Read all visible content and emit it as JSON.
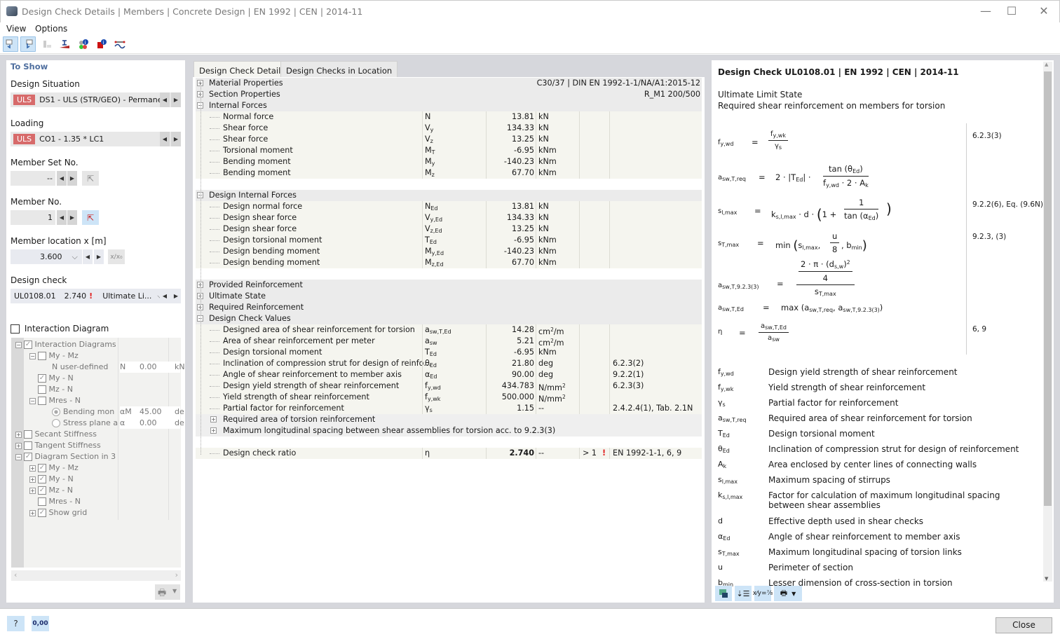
{
  "window": {
    "title": "Design Check Details | Members | Concrete Design | EN 1992 | CEN | 2014-11",
    "minimize": "—",
    "maximize": "☐",
    "close": "✕"
  },
  "menu": [
    "View",
    "Options"
  ],
  "toolbar": {
    "icons": [
      "select-previous-icon",
      "select-next-icon",
      "list-icon",
      "section-icon",
      "info-colors-icon",
      "member-info-icon",
      "reinforcement-icon"
    ]
  },
  "left": {
    "section_title": "To Show",
    "design_situation": {
      "label": "Design Situation",
      "badge": "ULS",
      "value": "DS1 - ULS (STR/GEO) - Permane..."
    },
    "loading": {
      "label": "Loading",
      "badge": "ULS",
      "value": "CO1 - 1.35 * LC1"
    },
    "member_set": {
      "label": "Member Set No.",
      "value": "--"
    },
    "member_no": {
      "label": "Member No.",
      "value": "1"
    },
    "member_location": {
      "label": "Member location x [m]",
      "value": "3.600",
      "ratio_btn": "x/x₀"
    },
    "design_check": {
      "label": "Design check",
      "id": "UL0108.01",
      "ratio": "2.740",
      "type": "Ultimate Li..."
    },
    "interaction_diagram": {
      "label": "Interaction Diagram",
      "checked": false
    },
    "tree": [
      {
        "label": "Interaction Diagrams",
        "level": 0,
        "expander": "−",
        "checked": true
      },
      {
        "label": "My - Mz",
        "level": 1,
        "expander": "−",
        "checked": false
      },
      {
        "label": "N user-defined",
        "level": 2,
        "sym": "N",
        "value": "0.00",
        "unit": "kN"
      },
      {
        "label": "My - N",
        "level": 1,
        "checked": true
      },
      {
        "label": "Mz - N",
        "level": 1,
        "checked": false
      },
      {
        "label": "Mres - N",
        "level": 1,
        "expander": "−",
        "checked": false
      },
      {
        "label": "Bending mon",
        "level": 2,
        "radio": true,
        "selected": true,
        "sym": "αM",
        "value": "45.00",
        "unit": "de"
      },
      {
        "label": "Stress plane a",
        "level": 2,
        "radio": true,
        "selected": false,
        "sym": "α",
        "value": "0.00",
        "unit": "de"
      },
      {
        "label": "Secant Stiffness",
        "level": 0,
        "expander": "+",
        "checked": false
      },
      {
        "label": "Tangent Stiffness",
        "level": 0,
        "expander": "+",
        "checked": false
      },
      {
        "label": "Diagram Section in 3",
        "level": 0,
        "expander": "−",
        "checked": true
      },
      {
        "label": "My - Mz",
        "level": 1,
        "expander": "+",
        "checked": true
      },
      {
        "label": "My - N",
        "level": 1,
        "expander": "+",
        "checked": true
      },
      {
        "label": "Mz - N",
        "level": 1,
        "expander": "+",
        "checked": true
      },
      {
        "label": "Mres - N",
        "level": 1,
        "checked": false
      },
      {
        "label": "Show grid",
        "level": 1,
        "expander": "+",
        "checked": true
      }
    ]
  },
  "center": {
    "tabs": [
      "Design Check Details",
      "Design Checks in Location"
    ],
    "rows": [
      {
        "type": "hdr",
        "exp": "+",
        "label": "Material Properties",
        "right": "C30/37 | DIN EN 1992-1-1/NA/A1:2015-12"
      },
      {
        "type": "hdr",
        "exp": "+",
        "label": "Section Properties",
        "right": "R_M1 200/500"
      },
      {
        "type": "hdr",
        "exp": "−",
        "label": "Internal Forces"
      },
      {
        "type": "sub",
        "label": "Normal force",
        "sym": "N",
        "val": "13.81",
        "unit": "kN"
      },
      {
        "type": "sub",
        "label": "Shear force",
        "sym": "V<sub>y</sub>",
        "val": "134.33",
        "unit": "kN"
      },
      {
        "type": "sub",
        "label": "Shear force",
        "sym": "V<sub>z</sub>",
        "val": "13.25",
        "unit": "kN"
      },
      {
        "type": "sub",
        "label": "Torsional moment",
        "sym": "M<sub>T</sub>",
        "val": "-6.95",
        "unit": "kNm"
      },
      {
        "type": "sub",
        "label": "Bending moment",
        "sym": "M<sub>y</sub>",
        "val": "-140.23",
        "unit": "kNm"
      },
      {
        "type": "sub",
        "label": "Bending moment",
        "sym": "M<sub>z</sub>",
        "val": "67.70",
        "unit": "kNm"
      },
      {
        "type": "blank"
      },
      {
        "type": "hdr",
        "exp": "−",
        "label": "Design Internal Forces"
      },
      {
        "type": "sub",
        "label": "Design normal force",
        "sym": "N<sub>Ed</sub>",
        "val": "13.81",
        "unit": "kN"
      },
      {
        "type": "sub",
        "label": "Design shear force",
        "sym": "V<sub>y,Ed</sub>",
        "val": "134.33",
        "unit": "kN"
      },
      {
        "type": "sub",
        "label": "Design shear force",
        "sym": "V<sub>z,Ed</sub>",
        "val": "13.25",
        "unit": "kN"
      },
      {
        "type": "sub",
        "label": "Design torsional moment",
        "sym": "T<sub>Ed</sub>",
        "val": "-6.95",
        "unit": "kNm"
      },
      {
        "type": "sub",
        "label": "Design bending moment",
        "sym": "M<sub>y,Ed</sub>",
        "val": "-140.23",
        "unit": "kNm"
      },
      {
        "type": "sub",
        "label": "Design bending moment",
        "sym": "M<sub>z,Ed</sub>",
        "val": "67.70",
        "unit": "kNm"
      },
      {
        "type": "blank"
      },
      {
        "type": "hdr",
        "exp": "+",
        "label": "Provided Reinforcement"
      },
      {
        "type": "hdr",
        "exp": "+",
        "label": "Ultimate State"
      },
      {
        "type": "hdr",
        "exp": "+",
        "label": "Required Reinforcement"
      },
      {
        "type": "hdr",
        "exp": "−",
        "label": "Design Check Values"
      },
      {
        "type": "sub",
        "label": "Designed area of shear reinforcement for torsion",
        "sym": "a<sub>sw,T,Ed</sub>",
        "val": "14.28",
        "unit": "cm<sup>2</sup>/m"
      },
      {
        "type": "sub",
        "label": "Area of shear reinforcement per meter",
        "sym": "a<sub>sw</sub>",
        "val": "5.21",
        "unit": "cm<sup>2</sup>/m"
      },
      {
        "type": "sub",
        "label": "Design torsional moment",
        "sym": "T<sub>Ed</sub>",
        "val": "-6.95",
        "unit": "kNm"
      },
      {
        "type": "sub",
        "label": "Inclination of compression strut for design of reinfo...",
        "sym": "θ<sub>Ed</sub>",
        "val": "21.80",
        "unit": "deg",
        "ref": "6.2.3(2)"
      },
      {
        "type": "sub",
        "label": "Angle of shear reinforcement to member axis",
        "sym": "α<sub>Ed</sub>",
        "val": "90.00",
        "unit": "deg",
        "ref": "9.2.2(1)"
      },
      {
        "type": "sub",
        "label": "Design yield strength of shear reinforcement",
        "sym": "f<sub>y,wd</sub>",
        "val": "434.783",
        "unit": "N/mm<sup>2</sup>",
        "ref": "6.2.3(3)"
      },
      {
        "type": "sub",
        "label": "Yield strength of shear reinforcement",
        "sym": "f<sub>y,wk</sub>",
        "val": "500.000",
        "unit": "N/mm<sup>2</sup>"
      },
      {
        "type": "sub",
        "label": "Partial factor for reinforcement",
        "sym": "γ<sub>s</sub>",
        "val": "1.15",
        "unit": "--",
        "ref": "2.4.2.4(1), Tab. 2.1N"
      },
      {
        "type": "subhdr",
        "exp": "+",
        "label": "Required area of torsion reinforcement"
      },
      {
        "type": "subhdr",
        "exp": "+",
        "label": "Maximum longitudinal spacing between shear assemblies for torsion acc. to 9.2.3(3)"
      },
      {
        "type": "blank"
      },
      {
        "type": "ratio",
        "label": "Design check ratio",
        "sym": "η",
        "val": "2.740",
        "unit": "--",
        "lim": "> 1",
        "ref": "EN 1992-1-1, 6, 9"
      }
    ]
  },
  "right": {
    "title": "Design Check UL0108.01 | EN 1992 | CEN | 2014-11",
    "line1": "Ultimate Limit State",
    "line2": "Required shear reinforcement on members for torsion",
    "formula_refs": [
      "6.2.3(3)",
      "9.2.2(6), Eq. (9.6N)",
      "9.2.3, (3)",
      "6, 9"
    ],
    "legend": [
      {
        "sym": "f<sub>y,wd</sub>",
        "text": "Design yield strength of shear reinforcement"
      },
      {
        "sym": "f<sub>y,wk</sub>",
        "text": "Yield strength of shear reinforcement"
      },
      {
        "sym": "γ<sub>s</sub>",
        "text": "Partial factor for reinforcement"
      },
      {
        "sym": "a<sub>sw,T,req</sub>",
        "text": "Required area of shear reinforcement for torsion"
      },
      {
        "sym": "T<sub>Ed</sub>",
        "text": "Design torsional moment"
      },
      {
        "sym": "θ<sub>Ed</sub>",
        "text": "Inclination of compression strut for design of reinforcement"
      },
      {
        "sym": "A<sub>k</sub>",
        "text": "Area enclosed by center lines of connecting walls"
      },
      {
        "sym": "s<sub>l,max</sub>",
        "text": "Maximum spacing of stirrups"
      },
      {
        "sym": "k<sub>s,l,max</sub>",
        "text": "Factor for calculation of maximum longitudinal spacing between shear assemblies"
      },
      {
        "sym": "d",
        "text": "Effective depth used in shear checks"
      },
      {
        "sym": "α<sub>Ed</sub>",
        "text": "Angle of shear reinforcement to member axis"
      },
      {
        "sym": "s<sub>T,max</sub>",
        "text": "Maximum longitudinal spacing of torsion links"
      },
      {
        "sym": "u",
        "text": "Perimeter of section"
      },
      {
        "sym": "b<sub>min</sub>",
        "text": "Lesser dimension of cross-section in torsion"
      }
    ]
  },
  "footer": {
    "close_label": "Close",
    "units_btn": "0,00"
  },
  "colors": {
    "uls_badge": "#d76a6a",
    "accent": "#cde4f7",
    "section_title": "#4f6f9f",
    "warning": "#e02020"
  }
}
